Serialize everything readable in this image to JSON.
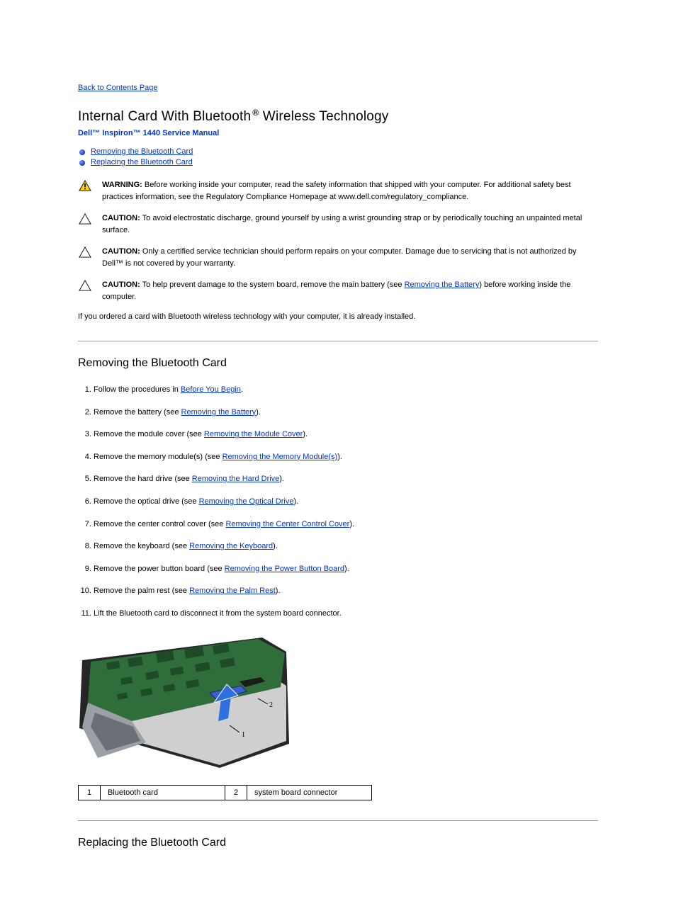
{
  "back_link": "Back to Contents Page",
  "title_prefix": "Internal Card With Bluetooth",
  "title_suffix": " Wireless Technology",
  "subtitle": "Dell™ Inspiron™ 1440 Service Manual",
  "toc": {
    "items": [
      {
        "label": "Removing the Bluetooth Card"
      },
      {
        "label": "Replacing the Bluetooth Card"
      }
    ]
  },
  "notices": [
    {
      "type": "warning",
      "lead": "WARNING:",
      "text": " Before working inside your computer, read the safety information that shipped with your computer. For additional safety best practices information, see the Regulatory Compliance Homepage at www.dell.com/regulatory_compliance."
    },
    {
      "type": "caution",
      "lead": "CAUTION:",
      "text": " To avoid electrostatic discharge, ground yourself by using a wrist grounding strap or by periodically touching an unpainted metal surface."
    },
    {
      "type": "caution",
      "lead": "CAUTION:",
      "text": " Only a certified service technician should perform repairs on your computer. Damage due to servicing that is not authorized by Dell™ is not covered by your warranty."
    },
    {
      "type": "caution",
      "lead": "CAUTION:",
      "pre": " To help prevent damage to the system board, remove the main battery (see ",
      "link": "Removing the Battery",
      "post": ") before working inside the computer."
    }
  ],
  "intro": "If you ordered a card with Bluetooth wireless technology with your computer, it is already installed.",
  "section1_title": "Removing the Bluetooth Card",
  "steps": [
    {
      "pre": "Follow the procedures in ",
      "link": "Before You Begin",
      "post": "."
    },
    {
      "pre": "Remove the battery (see ",
      "link": "Removing the Battery",
      "post": ")."
    },
    {
      "pre": "Remove the module cover (see ",
      "link": "Removing the Module Cover",
      "post": ")."
    },
    {
      "pre": "Remove the memory module(s) (see ",
      "link": "Removing the Memory Module(s)",
      "post": ")."
    },
    {
      "pre": "Remove the hard drive (see ",
      "link": "Removing the Hard Drive",
      "post": ")."
    },
    {
      "pre": "Remove the optical drive (see ",
      "link": "Removing the Optical Drive",
      "post": ")."
    },
    {
      "pre": "Remove the center control cover (see ",
      "link": "Removing the Center Control Cover",
      "post": ")."
    },
    {
      "pre": "Remove the keyboard (see ",
      "link": "Removing the Keyboard",
      "post": ")."
    },
    {
      "pre": "Remove the power button board (see ",
      "link": "Removing the Power Button Board",
      "post": ")."
    },
    {
      "pre": "Remove the palm rest (see ",
      "link": "Removing the Palm Rest",
      "post": ")."
    },
    {
      "pre": "Lift the Bluetooth card to disconnect it from the system board connector.",
      "link": "",
      "post": ""
    }
  ],
  "legend": {
    "r1n": "1",
    "r1t": "Bluetooth card",
    "r2n": "2",
    "r2t": "system board connector"
  },
  "section2_title": "Replacing the Bluetooth Card"
}
